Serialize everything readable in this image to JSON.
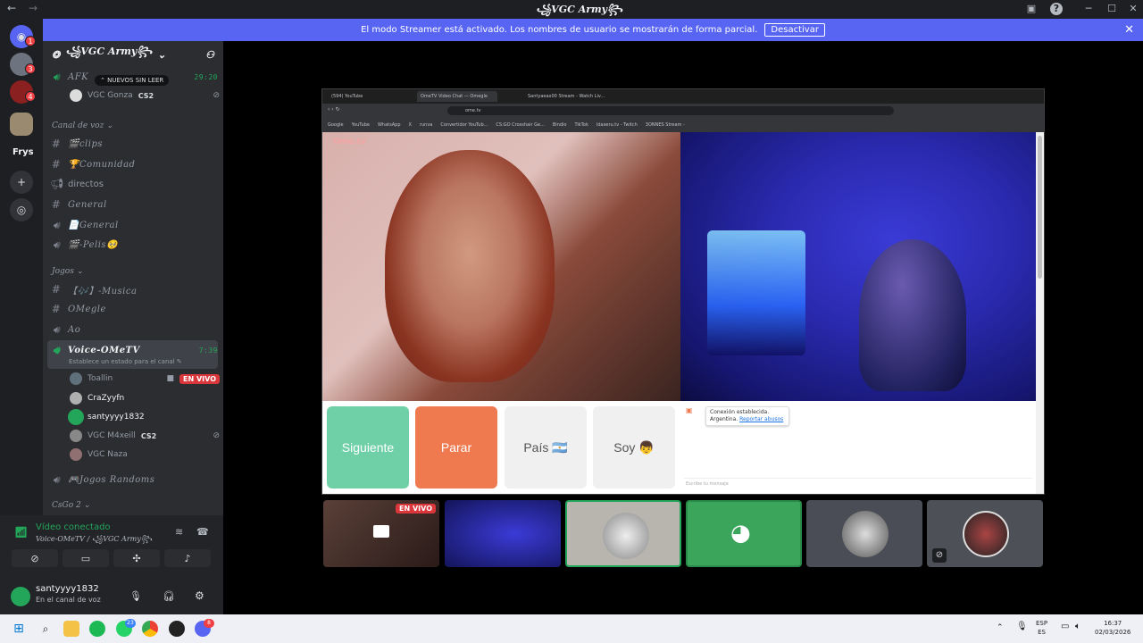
{
  "titlebar": {
    "title": "꧁VGC Army꧂"
  },
  "banner": {
    "text": "El modo Streamer está activado. Los nombres de usuario se mostrarán de forma parcial.",
    "button": "Desactivar"
  },
  "rail": {
    "badges": [
      "1",
      "3",
      "4"
    ],
    "folder_label": "Frys"
  },
  "server": {
    "name": "꧁VGC Army꧂",
    "afk_channel": "AFK",
    "afk_time": "29:20",
    "afk_member": "VGC Gonza",
    "afk_member_tag": "CS2",
    "unread_pill": "NUEVOS SIN LEER",
    "category_voice": "Canal de voz",
    "channels": [
      {
        "type": "text",
        "name": "🎬clips"
      },
      {
        "type": "text",
        "name": "🏆Comunidad"
      },
      {
        "type": "announce",
        "name": "directos"
      },
      {
        "type": "text",
        "name": "General"
      },
      {
        "type": "voice",
        "name": "📄General"
      },
      {
        "type": "voice",
        "name": "🎬-Pelis🥺"
      }
    ],
    "category_games": "Jogos",
    "games_channels": [
      {
        "type": "text",
        "name": "【🎶】-Musica"
      },
      {
        "type": "text",
        "name": "OMegle"
      },
      {
        "type": "voice",
        "name": "Ao"
      }
    ],
    "active_channel": {
      "name": "Voice-OMeTV",
      "time": "7:39",
      "status_hint": "Establece un estado para el canal"
    },
    "active_members": [
      {
        "name": "Toallin",
        "live": "EN VIVO"
      },
      {
        "name": "CraZyyfn"
      },
      {
        "name": "santyyyy1832"
      },
      {
        "name": "VGC M4xeill",
        "tag": "CS2"
      },
      {
        "name": "VGC Naza"
      }
    ],
    "last_channel": "🎮Jogos Randoms",
    "last_category": "CsGo 2"
  },
  "voice_panel": {
    "status": "Vídeo conectado",
    "location": "Voice-OMeTV / ꧁VGC Army꧂"
  },
  "user": {
    "name": "santyyyy1832",
    "status": "En el canal de voz"
  },
  "browser": {
    "tabs": [
      "(594) YouTube",
      "OmeTV Video Chat — Omegle",
      "Santyaeax00 Stream - Watch Liv..."
    ],
    "url": "ome.tv",
    "bookmarks": [
      "Google",
      "YouTube",
      "WhatsApp",
      "X",
      "runva",
      "Convertidor YouTub...",
      "CS:GO Crosshair Ge...",
      "Bindio",
      "TikTok",
      "Idaxeru.tv - Twitch",
      "3ONNES Stream -"
    ]
  },
  "ometv": {
    "logo": "Ome.tv",
    "btn_next": "Siguiente",
    "btn_stop": "Parar",
    "btn_country": "País 🇦🇷",
    "btn_me": "Soy 👦",
    "chat_line1": "Conexión establecida.",
    "chat_line2": "Argentina.",
    "chat_link": "Reportar abusos",
    "chat_placeholder": "Escribe tu mensaje"
  },
  "tiles": {
    "live_label": "EN VIVO"
  },
  "taskbar": {
    "whatsapp_badge": "23",
    "discord_badge": "8",
    "lang_top": "ESP",
    "lang_bottom": "ES",
    "time": "16:37",
    "date": "02/03/2026"
  },
  "colors": {
    "discord_blurple": "#5865f2",
    "ome_green": "#6fd0a8",
    "ome_orange": "#f07a50",
    "live_red": "#da373c",
    "connected_green": "#23a55a"
  }
}
